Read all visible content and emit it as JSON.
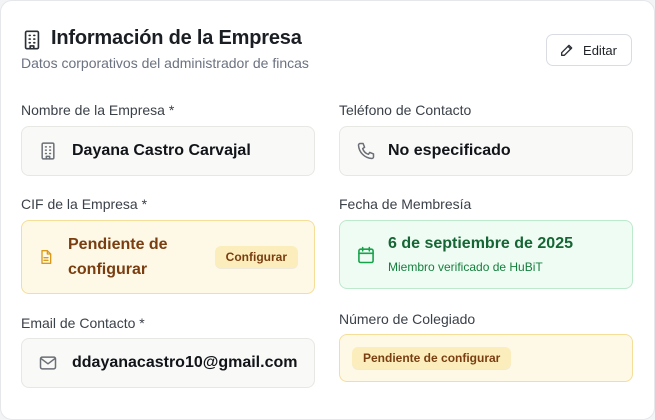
{
  "header": {
    "title": "Información de la Empresa",
    "subtitle": "Datos corporativos del administrador de fincas",
    "edit_label": "Editar"
  },
  "fields": {
    "company_name": {
      "label": "Nombre de la Empresa *",
      "value": "Dayana Castro Carvajal",
      "icon": "building-icon"
    },
    "phone": {
      "label": "Teléfono de Contacto",
      "value": "No especificado",
      "icon": "phone-icon"
    },
    "cif": {
      "label": "CIF de la Empresa *",
      "status": "Pendiente de configurar",
      "action_label": "Configurar",
      "icon": "document-icon"
    },
    "membership": {
      "label": "Fecha de Membresía",
      "value": "6 de septiembre de 2025",
      "note": "Miembro verificado de HuBiT",
      "icon": "calendar-icon"
    },
    "email": {
      "label": "Email de Contacto *",
      "value": "ddayanacastro10@gmail.com",
      "icon": "mail-icon"
    },
    "registration_number": {
      "label": "Número de Colegiado",
      "status": "Pendiente de configurar"
    }
  },
  "colors": {
    "warning_bg": "#fef9e7",
    "warning_text": "#7a3d10",
    "success_bg": "#effcf4",
    "success_text": "#166534",
    "accent_icon_warning": "#d99a1a",
    "accent_icon_success": "#16a34a"
  }
}
